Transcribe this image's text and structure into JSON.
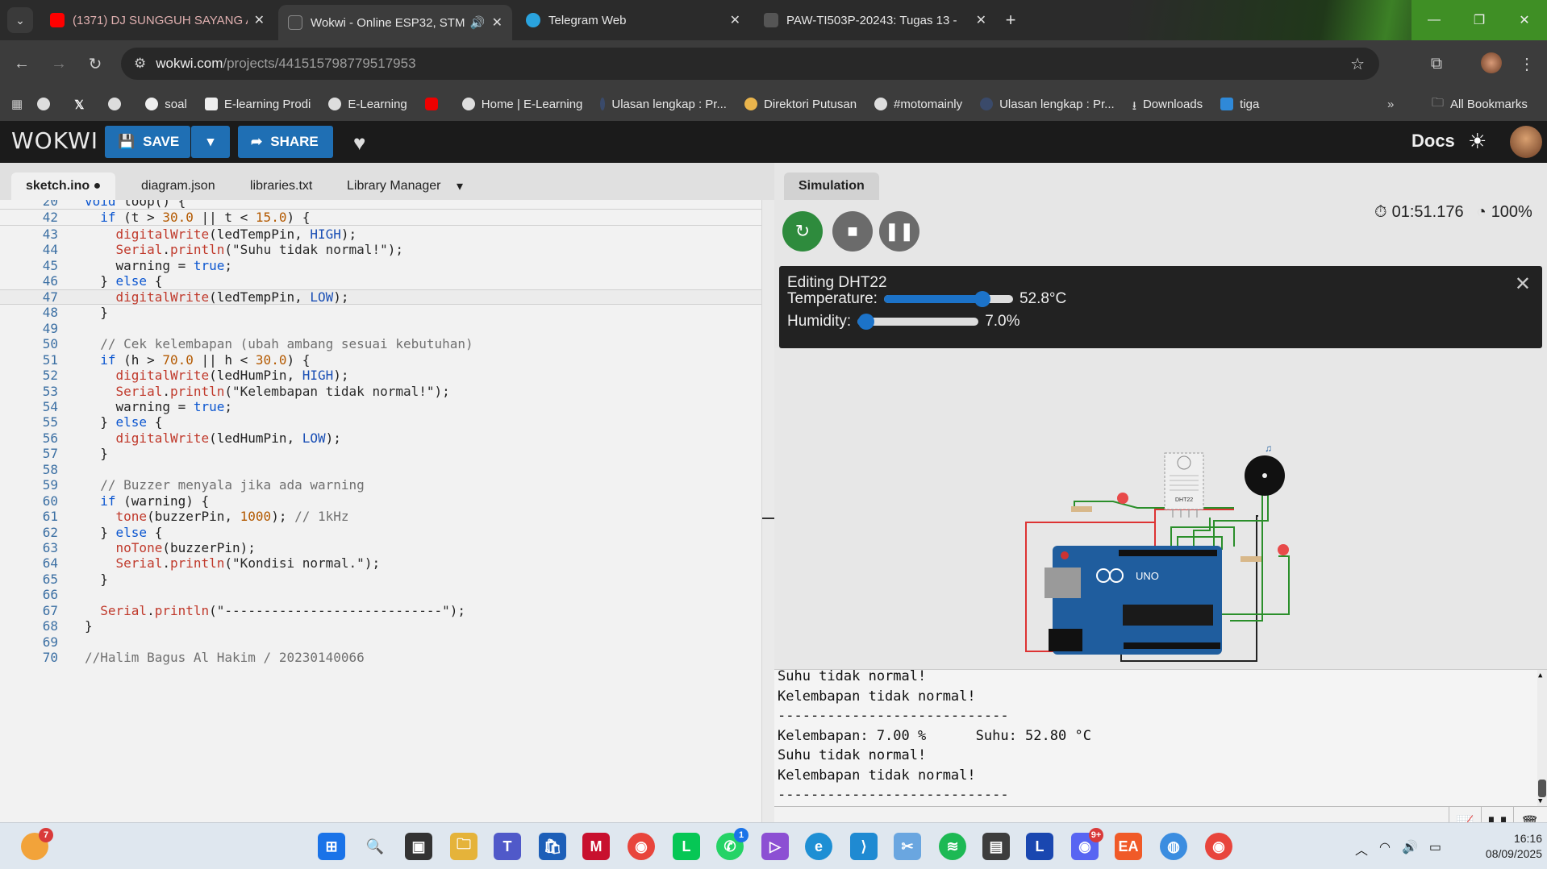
{
  "browser": {
    "tabs": [
      {
        "title": "(1371) DJ SUNGGUH SAYANG A",
        "favicon": "youtube-icon"
      },
      {
        "title": "Wokwi - Online ESP32, STM",
        "favicon": "wokwi-icon"
      },
      {
        "title": "Telegram Web",
        "favicon": "telegram-icon"
      },
      {
        "title": "PAW-TI503P-20243: Tugas 13 -",
        "favicon": "moodle-icon"
      }
    ],
    "url_host": "wokwi.com",
    "url_path": "/projects/441515798779517953",
    "bookmarks": [
      {
        "label": "",
        "icon": "globe-icon"
      },
      {
        "label": "",
        "icon": "x-icon"
      },
      {
        "label": "",
        "icon": "globe-icon"
      },
      {
        "label": "soal",
        "icon": "ghost-icon"
      },
      {
        "label": "E-learning Prodi",
        "icon": "moodle-icon"
      },
      {
        "label": "E-Learning",
        "icon": "globe-icon"
      },
      {
        "label": "",
        "icon": "youtube-icon"
      },
      {
        "label": "Home | E-Learning",
        "icon": "globe-icon"
      },
      {
        "label": "Ulasan lengkap : Pr...",
        "icon": "blog-icon"
      },
      {
        "label": "Direktori Putusan",
        "icon": "scale-icon"
      },
      {
        "label": "#motomainly",
        "icon": "globe-icon"
      },
      {
        "label": "Ulasan lengkap : Pr...",
        "icon": "blog-icon"
      },
      {
        "label": "Downloads",
        "icon": "download-icon"
      },
      {
        "label": "tiga",
        "icon": "sheet-icon"
      }
    ],
    "more": "»",
    "all_bookmarks": "All Bookmarks"
  },
  "wokwi": {
    "logo": "WOKWI",
    "save_label": "SAVE",
    "share_label": "SHARE",
    "docs_label": "Docs"
  },
  "editor": {
    "tabs": [
      "sketch.ino ●",
      "diagram.json",
      "libraries.txt",
      "Library Manager"
    ],
    "sticky": [
      {
        "n": "20",
        "t": "void loop() {"
      },
      {
        "n": "42",
        "t": "  if (t > 30.0 || t < 15.0) {"
      }
    ],
    "lines": [
      {
        "n": "43",
        "t": "    digitalWrite(ledTempPin, HIGH);"
      },
      {
        "n": "44",
        "t": "    Serial.println(\"Suhu tidak normal!\");"
      },
      {
        "n": "45",
        "t": "    warning = true;"
      },
      {
        "n": "46",
        "t": "  } else {"
      },
      {
        "n": "47",
        "t": "    digitalWrite(ledTempPin, LOW);"
      },
      {
        "n": "48",
        "t": "  }"
      },
      {
        "n": "49",
        "t": ""
      },
      {
        "n": "50",
        "t": "  // Cek kelembapan (ubah ambang sesuai kebutuhan)"
      },
      {
        "n": "51",
        "t": "  if (h > 70.0 || h < 30.0) {"
      },
      {
        "n": "52",
        "t": "    digitalWrite(ledHumPin, HIGH);"
      },
      {
        "n": "53",
        "t": "    Serial.println(\"Kelembapan tidak normal!\");"
      },
      {
        "n": "54",
        "t": "    warning = true;"
      },
      {
        "n": "55",
        "t": "  } else {"
      },
      {
        "n": "56",
        "t": "    digitalWrite(ledHumPin, LOW);"
      },
      {
        "n": "57",
        "t": "  }"
      },
      {
        "n": "58",
        "t": ""
      },
      {
        "n": "59",
        "t": "  // Buzzer menyala jika ada warning"
      },
      {
        "n": "60",
        "t": "  if (warning) {"
      },
      {
        "n": "61",
        "t": "    tone(buzzerPin, 1000); // 1kHz"
      },
      {
        "n": "62",
        "t": "  } else {"
      },
      {
        "n": "63",
        "t": "    noTone(buzzerPin);"
      },
      {
        "n": "64",
        "t": "    Serial.println(\"Kondisi normal.\");"
      },
      {
        "n": "65",
        "t": "  }"
      },
      {
        "n": "66",
        "t": ""
      },
      {
        "n": "67",
        "t": "  Serial.println(\"----------------------------\");"
      },
      {
        "n": "68",
        "t": "}"
      },
      {
        "n": "69",
        "t": ""
      },
      {
        "n": "70",
        "t": "//Halim Bagus Al Hakim / 20230140066"
      }
    ],
    "current_line": "47"
  },
  "simulation": {
    "tab_label": "Simulation",
    "timer": "01:51.176",
    "speed": "100%",
    "edit_title": "Editing DHT22",
    "temperature_label": "Temperature:",
    "temperature_value": "52.8°C",
    "temperature_fraction": 0.76,
    "humidity_label": "Humidity:",
    "humidity_value": "7.0%",
    "humidity_fraction": 0.07,
    "board_label": "UNO",
    "sensor_label": "DHT22",
    "serial_lines": [
      "Suhu tidak normal!",
      "Kelembapan tidak normal!",
      "----------------------------",
      "Kelembapan: 7.00 %      Suhu: 52.80 °C",
      "Suhu tidak normal!",
      "Kelembapan tidak normal!",
      "----------------------------"
    ]
  },
  "taskbar": {
    "weather_badge": "7",
    "whatsapp_badge": "1",
    "discord_badge": "9+",
    "time": "16:16",
    "date": "08/09/2025"
  },
  "colors": {
    "accent_blue": "#1f6fb4",
    "sim_green": "#2e8b3d",
    "code_keyword": "#0b56d0",
    "code_function": "#c0392b"
  }
}
